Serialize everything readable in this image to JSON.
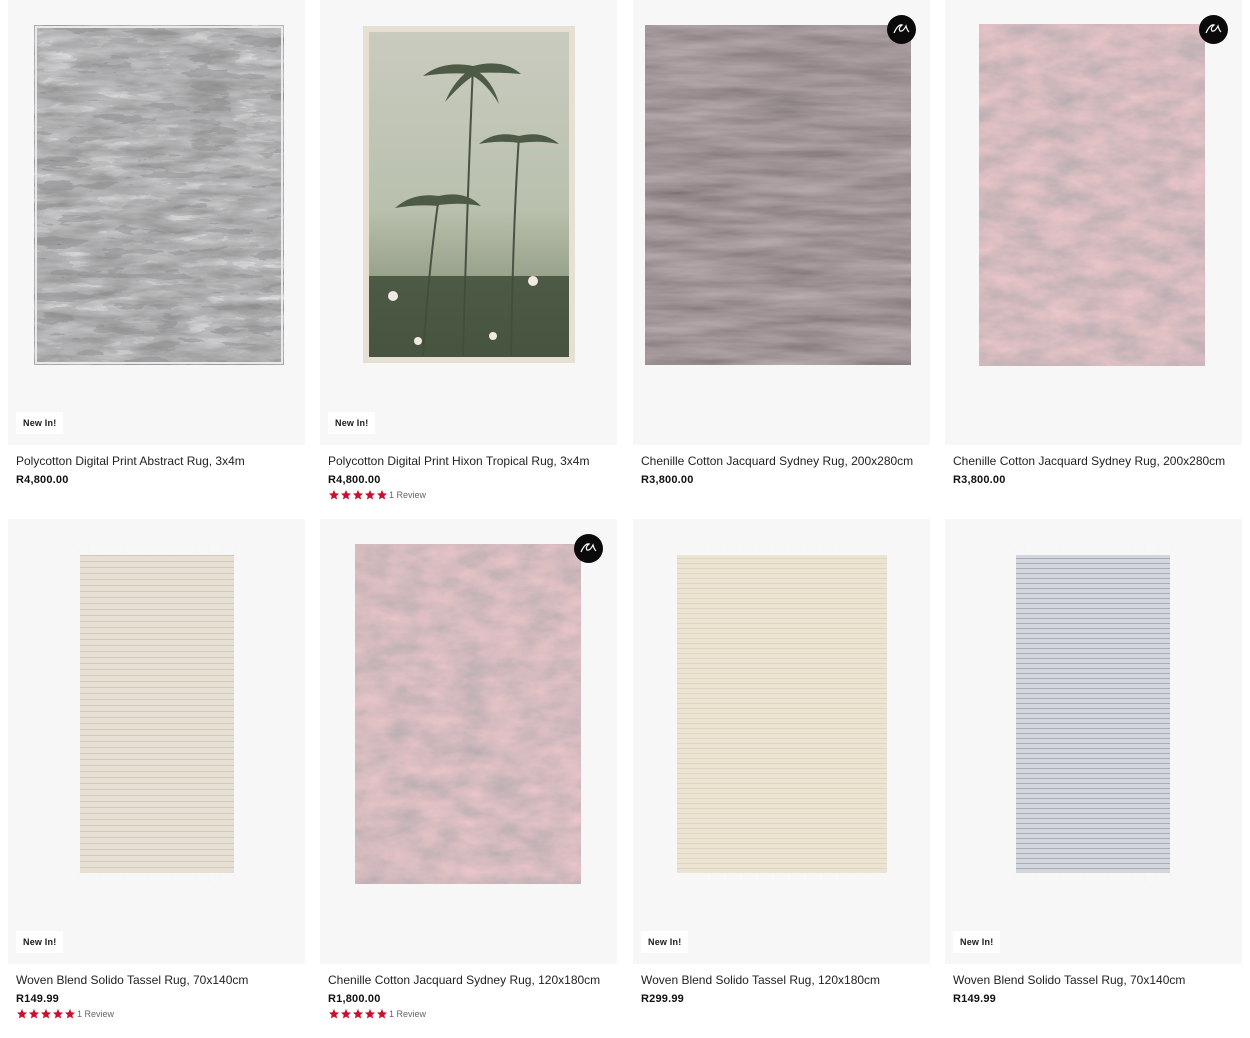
{
  "colors": {
    "star": "#c8102e",
    "tile_bg": "#f7f7f7",
    "badge_dark": "#0a0a0a"
  },
  "products": [
    {
      "title": "Polycotton Digital Print Abstract Rug, 3x4m",
      "price": "R4,800.00",
      "badge": "New In!",
      "extra": false,
      "rating": null,
      "review_text": "",
      "rug_style": "abstract-grey"
    },
    {
      "title": "Polycotton Digital Print Hixon Tropical Rug, 3x4m",
      "price": "R4,800.00",
      "badge": "New In!",
      "extra": false,
      "rating": 5,
      "review_text": "1 Review",
      "rug_style": "tropical-palms"
    },
    {
      "title": "Chenille Cotton Jacquard Sydney Rug, 200x280cm",
      "price": "R3,800.00",
      "badge": "",
      "extra": true,
      "rating": null,
      "review_text": "",
      "rug_style": "charcoal-stripe"
    },
    {
      "title": "Chenille Cotton Jacquard Sydney Rug, 200x280cm",
      "price": "R3,800.00",
      "badge": "",
      "extra": true,
      "rating": null,
      "review_text": "",
      "rug_style": "rust-distressed"
    },
    {
      "title": "Woven Blend Solido Tassel Rug, 70x140cm",
      "price": "R149.99",
      "badge": "New In!",
      "extra": false,
      "rating": 5,
      "review_text": "1 Review",
      "rug_style": "beige-tassel"
    },
    {
      "title": "Chenille Cotton Jacquard Sydney Rug, 120x180cm",
      "price": "R1,800.00",
      "badge": "",
      "extra": true,
      "rating": 5,
      "review_text": "1 Review",
      "rug_style": "rust-distressed"
    },
    {
      "title": "Woven Blend Solido Tassel Rug, 120x180cm",
      "price": "R299.99",
      "badge": "New In!",
      "extra": false,
      "rating": null,
      "review_text": "",
      "rug_style": "cream-tassel"
    },
    {
      "title": "Woven Blend Solido Tassel Rug, 70x140cm",
      "price": "R149.99",
      "badge": "New In!",
      "extra": false,
      "rating": null,
      "review_text": "",
      "rug_style": "grey-tassel"
    }
  ]
}
